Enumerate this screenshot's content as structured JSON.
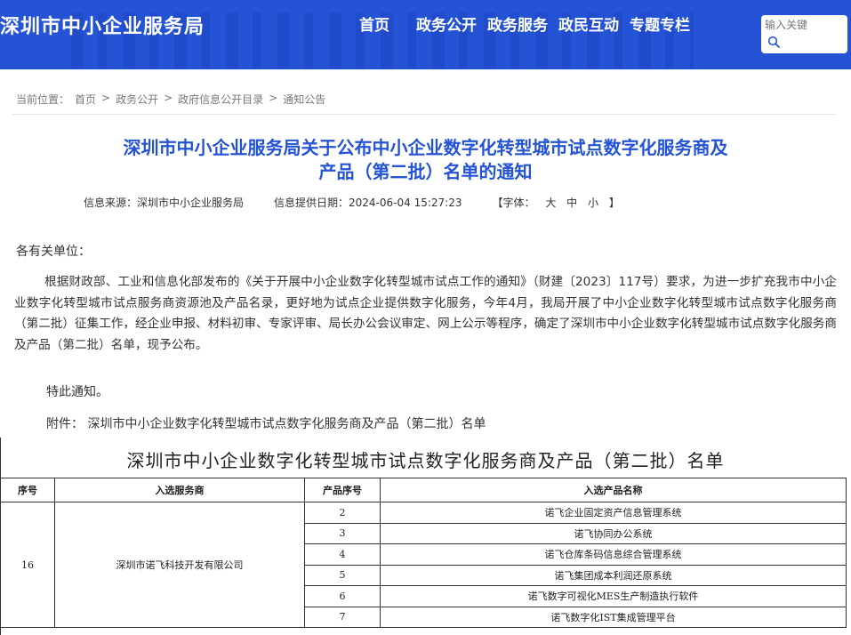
{
  "header": {
    "site_title": "深圳市中小企业服务局",
    "nav": [
      "首页",
      "政务公开",
      "政务服务",
      "政民互动",
      "专题专栏"
    ],
    "search_placeholder": "输入关键"
  },
  "breadcrumb": {
    "label": "当前位置：",
    "items": [
      "首页",
      "政务公开",
      "政府信息公开目录",
      "通知公告"
    ],
    "separator": ">"
  },
  "article": {
    "title_line1": "深圳市中小企业服务局关于公布中小企业数字化转型城市试点数字化服务商及",
    "title_line2": "产品（第二批）名单的通知",
    "source": "信息来源：深圳市中小企业服务局",
    "date": "信息提供日期：2024-06-04 15:27:23",
    "font_label": "【字体：",
    "font_sizes": [
      "大",
      "中",
      "小"
    ],
    "font_close": "】",
    "salutation": "各有关单位：",
    "paragraph": "根据财政部、工业和信息化部发布的《关于开展中小企业数字化转型城市试点工作的通知》（财建〔2023〕117号）要求，为进一步扩充我市中小企业数字化转型城市试点服务商资源池及产品名录，更好地为试点企业提供数字化服务，今年4月，我局开展了中小企业数字化转型城市试点数字化服务商（第二批）征集工作，经企业申报、材料初审、专家评审、局长办公会议审定、网上公示等程序，确定了深圳市中小企业数字化转型城市试点数字化服务商及产品（第二批）名单，现予公布。",
    "notice": "特此通知。",
    "attachment_label": "附件：",
    "attachment": "深圳市中小企业数字化转型城市试点数字化服务商及产品（第二批）名单"
  },
  "document": {
    "title": "深圳市中小企业数字化转型城市试点数字化服务商及产品（第二批）名单",
    "columns": [
      "序号",
      "入选服务商",
      "产品序号",
      "入选产品名称"
    ],
    "group_index": "16",
    "provider": "深圳市诺飞科技开发有限公司",
    "products": [
      {
        "no": "2",
        "name": "诺飞企业固定资产信息管理系统"
      },
      {
        "no": "3",
        "name": "诺飞协同办公系统"
      },
      {
        "no": "4",
        "name": "诺飞仓库条码信息综合管理系统"
      },
      {
        "no": "5",
        "name": "诺飞集团成本利润还原系统"
      },
      {
        "no": "6",
        "name": "诺飞数字可视化MES生产制造执行软件"
      },
      {
        "no": "7",
        "name": "诺飞数字化IST集成管理平台"
      }
    ]
  }
}
